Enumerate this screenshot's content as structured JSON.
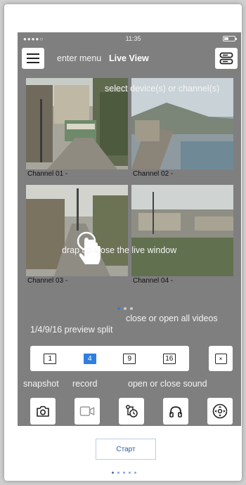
{
  "status_bar": {
    "signal": "●●●●○",
    "time": "11:35"
  },
  "header": {
    "title": "Live View",
    "menu_hint": "enter menu",
    "device_hint": "select device(s) or channel(s)"
  },
  "channels": [
    {
      "label": "Channel 01 -"
    },
    {
      "label": "Channel 02 -"
    },
    {
      "label": "Channel 03 -"
    },
    {
      "label": "Channel 04 -"
    }
  ],
  "hints": {
    "drag": "drap up close the live window",
    "close_all": "close or open all videos",
    "split": "1/4/9/16 preview split",
    "snapshot": "snapshot",
    "record": "record",
    "sound": "open or close sound"
  },
  "split_options": [
    {
      "label": "1",
      "active": false
    },
    {
      "label": "4",
      "active": true
    },
    {
      "label": "9",
      "active": false
    },
    {
      "label": "16",
      "active": false
    }
  ],
  "close_all_glyph": "×",
  "more_glyph": "›",
  "start_button": "Старт",
  "icons": [
    "menu-icon",
    "device-list-icon",
    "hand-pointer-icon",
    "close-all-icon",
    "camera-icon",
    "video-record-icon",
    "playback-icon",
    "headphones-icon",
    "ptz-icon"
  ],
  "colors": {
    "accent": "#2f7fe0",
    "screen_bg": "#7f7f7f",
    "start_text": "#2a5f9d"
  }
}
